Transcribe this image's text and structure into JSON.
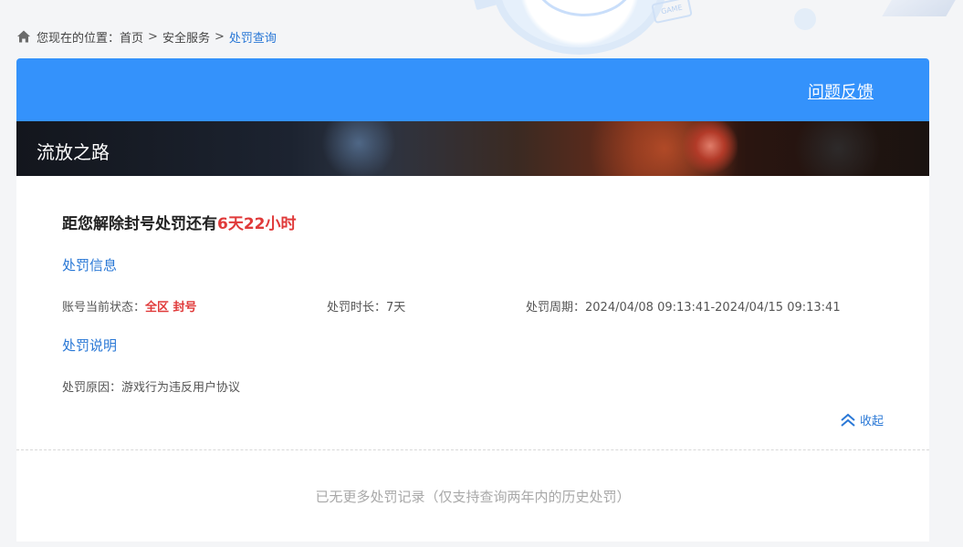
{
  "breadcrumb": {
    "prefix": "您现在的位置：",
    "items": [
      "首页",
      "安全服务"
    ],
    "separator": ">",
    "current": "处罚查询"
  },
  "header": {
    "feedback_label": "问题反馈"
  },
  "banner": {
    "game_title": "流放之路"
  },
  "penalty": {
    "countdown_prefix": "距您解除封号处罚还有",
    "countdown_value": "6天22小时",
    "info_title": "处罚信息",
    "status_label": "账号当前状态：",
    "status_value": "全区 封号",
    "duration_label": "处罚时长：",
    "duration_value": "7天",
    "period_label": "处罚周期：",
    "period_value": "2024/04/08 09:13:41-2024/04/15 09:13:41",
    "explain_title": "处罚说明",
    "reason_label": "处罚原因：",
    "reason_value": "游戏行为违反用户协议",
    "collapse_label": "收起"
  },
  "footer": {
    "no_more_text": "已无更多处罚记录（仅支持查询两年内的历史处罚）"
  },
  "colors": {
    "primary": "#3492fb",
    "link": "#2a78d6",
    "alert": "#e03a3a"
  },
  "icons": [
    "home-icon",
    "double-chevron-up-icon"
  ]
}
